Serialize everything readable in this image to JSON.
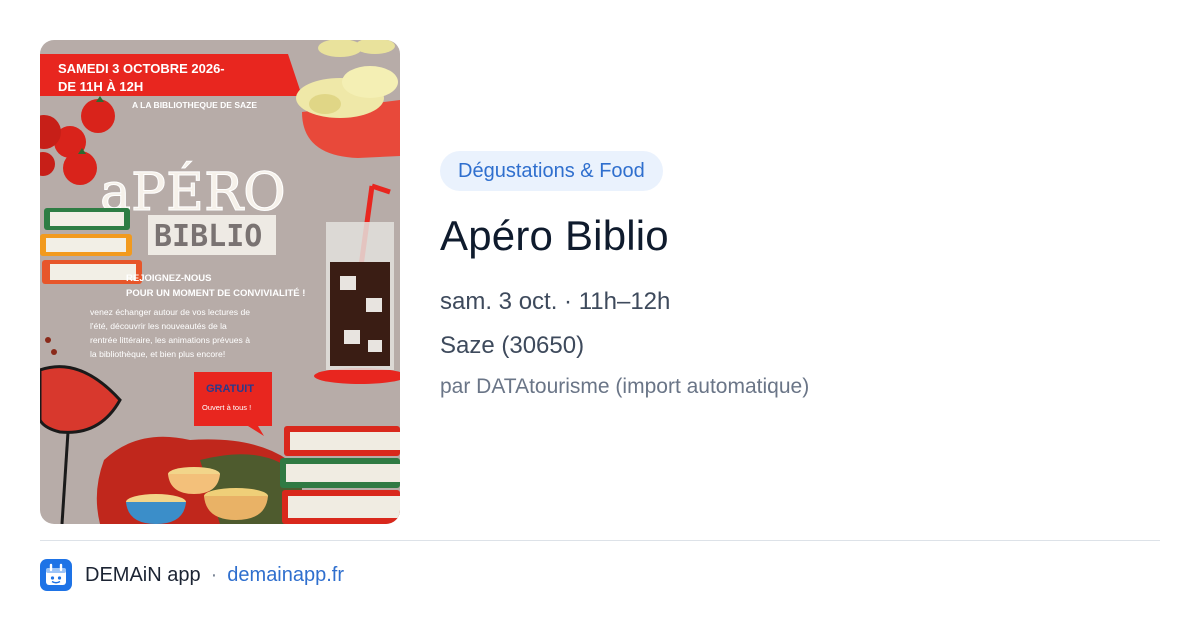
{
  "poster": {
    "date_line1": "SAMEDI 3 OCTOBRE  2026-",
    "date_line2": "DE 11H À 12H",
    "venue": "A LA BIBLIOTHEQUE DE SAZE",
    "word1": "aPÉRO",
    "word2": "BIBLIO",
    "tagline1": "REJOIGNEZ-NOUS",
    "tagline2": "POUR UN MOMENT DE CONVIVIALITÉ !",
    "body": [
      "venez échanger autour de vos lectures de",
      "l'été, découvrir les nouveautés de la",
      "rentrée littéraire, les animations prévues à",
      "la bibliothèque, et bien plus encore!"
    ],
    "badge_title": "GRATUIT",
    "badge_sub": "Ouvert à tous !"
  },
  "event": {
    "category": "Dégustations & Food",
    "title": "Apéro Biblio",
    "datetime": "sam. 3 oct. · 11h–12h",
    "location": "Saze (30650)",
    "organizer": "par DATAtourisme (import automatique)"
  },
  "footer": {
    "app_name": "DEMAiN app",
    "separator": "·",
    "domain": "demainapp.fr"
  },
  "colors": {
    "accent": "#2f6fce",
    "chip_bg": "#eaf2fd",
    "poster_bg": "#b7aca8",
    "poster_red": "#e8261f"
  }
}
